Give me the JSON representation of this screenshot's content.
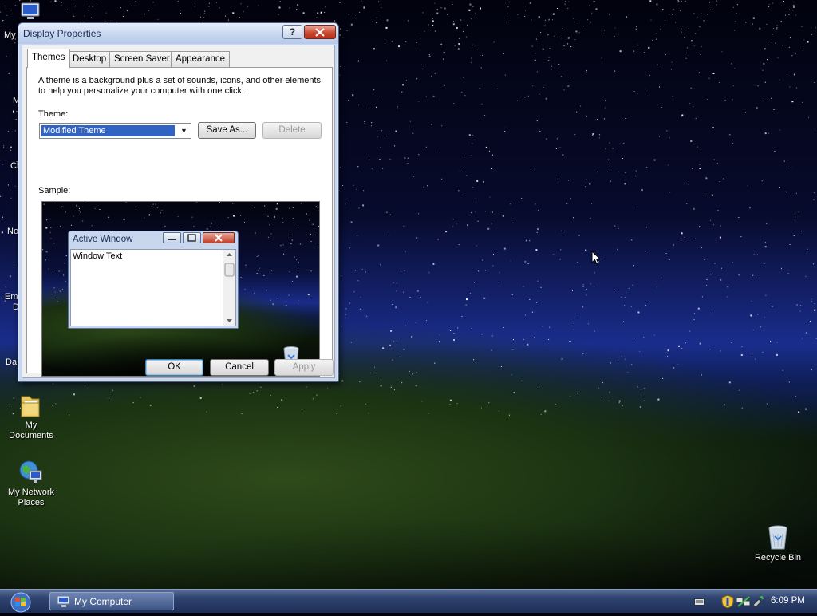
{
  "desktop": {
    "partial_labels": [
      "My",
      "M",
      "Cl",
      "No",
      "Em",
      "D",
      "Da"
    ],
    "icons": [
      {
        "label_line1": "My",
        "label_line2": "Documents",
        "icon": "folder-icon"
      },
      {
        "label_line1": "My Network",
        "label_line2": "Places",
        "icon": "network-globe-icon"
      },
      {
        "label_line1": "Recycle Bin",
        "label_line2": "",
        "icon": "recycle-bin-icon"
      }
    ]
  },
  "dialog": {
    "title": "Display Properties",
    "help_glyph": "?",
    "tabs": [
      "Themes",
      "Desktop",
      "Screen Saver",
      "Appearance"
    ],
    "active_tab": "Themes",
    "description": "A theme is a background plus a set of sounds, icons, and other elements to help you personalize your computer with one click.",
    "theme_label": "Theme:",
    "theme_value": "Modified Theme",
    "save_as_label": "Save As...",
    "delete_label": "Delete",
    "sample_label": "Sample:",
    "sample_window": {
      "title": "Active Window",
      "text": "Window Text"
    },
    "ok_label": "OK",
    "cancel_label": "Cancel",
    "apply_label": "Apply"
  },
  "taskbar": {
    "task_label": "My Computer",
    "clock": "6:09 PM"
  },
  "colors": {
    "selection": "#3163c2",
    "close_button": "#cc4a32",
    "taskbar": "#1e2f57"
  }
}
